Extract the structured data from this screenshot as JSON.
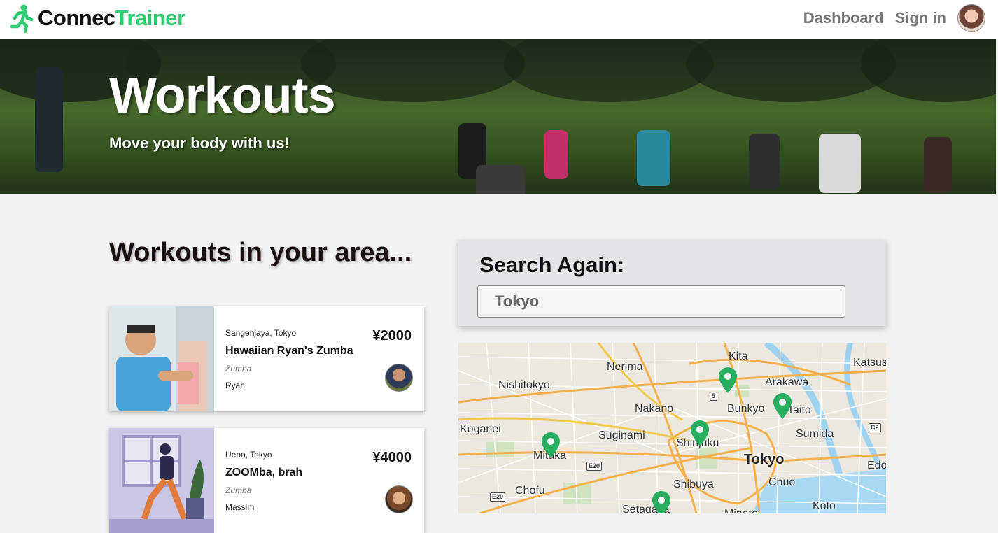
{
  "nav": {
    "brand_part1": "Connec",
    "brand_part2": "Trainer",
    "dashboard_label": "Dashboard",
    "signin_label": "Sign in"
  },
  "hero": {
    "title": "Workouts",
    "subtitle": "Move your body with us!"
  },
  "listing": {
    "title": "Workouts in your area...",
    "cards": [
      {
        "location": "Sangenjaya, Tokyo",
        "name": "Hawaiian Ryan's Zumba",
        "category": "Zumba",
        "host": "Ryan",
        "price": "¥2000"
      },
      {
        "location": "Ueno, Tokyo",
        "name": "ZOOMba, brah",
        "category": "Zumba",
        "host": "Massim",
        "price": "¥4000"
      }
    ]
  },
  "search": {
    "title": "Search Again:",
    "value": "Tokyo"
  },
  "map": {
    "labels": {
      "kita": "Kita",
      "katsu": "Katsus",
      "nerima": "Nerima",
      "nishitokyo": "Nishitokyo",
      "arakawa": "Arakawa",
      "nakano": "Nakano",
      "bunkyo": "Bunkyo",
      "taito": "Taito",
      "koganei": "Koganei",
      "suginami": "Suginami",
      "shinjuku": "Shinjuku",
      "sumida": "Sumida",
      "mitaka": "Mitaka",
      "tokyo": "Tokyo",
      "edo": "Edo",
      "chofu": "Chofu",
      "shibuya": "Shibuya",
      "chuo": "Chuo",
      "setagaya": "Setagaya",
      "koto": "Koto",
      "minato": "Minato"
    },
    "shields": {
      "r5": "5",
      "e20a": "E20",
      "e20b": "E20",
      "c2": "C2"
    },
    "pin_color": "#27ae60"
  },
  "colors": {
    "brand_green": "#2ecc71",
    "pin_green": "#27ae60"
  }
}
